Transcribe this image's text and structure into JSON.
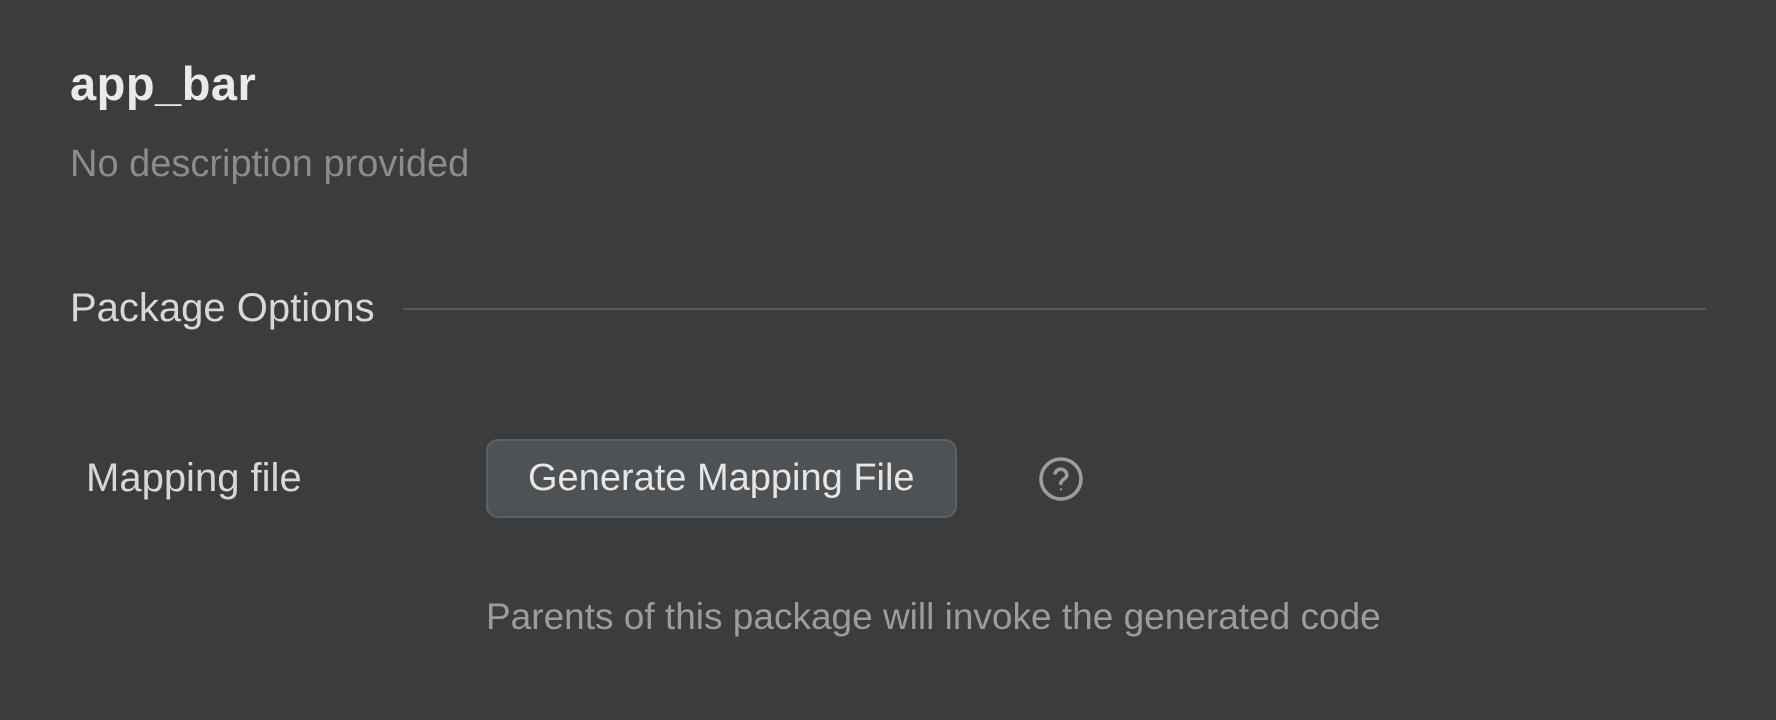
{
  "header": {
    "title": "app_bar",
    "subtitle": "No description provided"
  },
  "section": {
    "title": "Package Options"
  },
  "options": {
    "mapping_file": {
      "label": "Mapping file",
      "button_label": "Generate Mapping File",
      "hint": "Parents of this package will invoke the generated code"
    }
  }
}
